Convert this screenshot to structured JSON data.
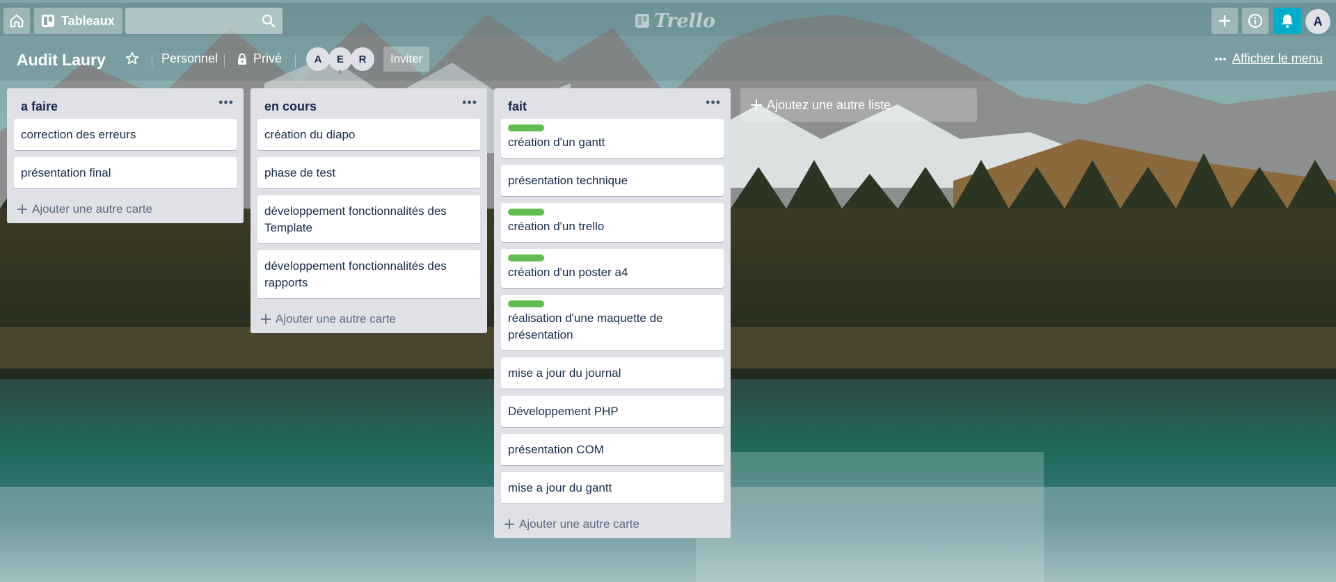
{
  "topbar": {
    "boards_label": "Tableaux",
    "search_value": "",
    "logo_text": "Trello",
    "avatar_initial": "A"
  },
  "board": {
    "title": "Audit Laury",
    "team_label": "Personnel",
    "visibility_label": "Privé",
    "members": [
      "A",
      "E",
      "R"
    ],
    "invite_label": "Inviter",
    "menu_label": "Afficher le menu"
  },
  "lists": [
    {
      "title": "a faire",
      "cards": [
        {
          "text": "correction des erreurs",
          "label": false
        },
        {
          "text": "présentation final",
          "label": false
        }
      ],
      "add_card_label": "Ajouter une autre carte"
    },
    {
      "title": "en cours",
      "cards": [
        {
          "text": "création du diapo",
          "label": false
        },
        {
          "text": "phase de test",
          "label": false
        },
        {
          "text": "développement fonctionnalités des Template",
          "label": false
        },
        {
          "text": "développement fonctionnalités des rapports",
          "label": false
        }
      ],
      "add_card_label": "Ajouter une autre carte"
    },
    {
      "title": "fait",
      "cards": [
        {
          "text": "création d'un gantt",
          "label": true
        },
        {
          "text": "présentation technique",
          "label": false
        },
        {
          "text": "création d'un trello",
          "label": true
        },
        {
          "text": "création d'un poster a4",
          "label": true
        },
        {
          "text": "réalisation d'une maquette de présentation",
          "label": true
        },
        {
          "text": "mise a jour du journal",
          "label": false
        },
        {
          "text": "Développement PHP",
          "label": false
        },
        {
          "text": "présentation COM",
          "label": false
        },
        {
          "text": "mise a jour du gantt",
          "label": false
        }
      ],
      "add_card_label": "Ajouter une autre carte"
    }
  ],
  "add_list_label": "Ajoutez une autre liste",
  "colors": {
    "label_green": "#61bd4f",
    "notification_accent": "#00aecc",
    "list_background": "#dfe1e6",
    "text_primary": "#172b4d"
  }
}
